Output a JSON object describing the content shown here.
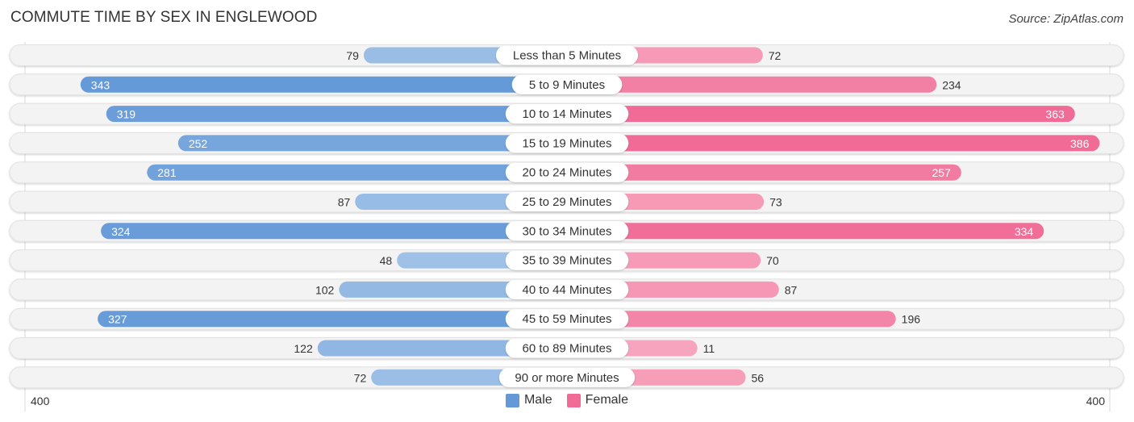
{
  "header": {
    "title": "COMMUTE TIME BY SEX IN ENGLEWOOD",
    "source": "Source: ZipAtlas.com"
  },
  "colors": {
    "male": "#6499d8",
    "male_light": "#a8c7e9",
    "female": "#f06b96",
    "female_light": "#f7a6bf",
    "track": "#f3f3f3"
  },
  "chart_data": {
    "type": "bar",
    "orientation": "horizontal-diverging",
    "title": "COMMUTE TIME BY SEX IN ENGLEWOOD",
    "categories": [
      "Less than 5 Minutes",
      "5 to 9 Minutes",
      "10 to 14 Minutes",
      "15 to 19 Minutes",
      "20 to 24 Minutes",
      "25 to 29 Minutes",
      "30 to 34 Minutes",
      "35 to 39 Minutes",
      "40 to 44 Minutes",
      "45 to 59 Minutes",
      "60 to 89 Minutes",
      "90 or more Minutes"
    ],
    "series": [
      {
        "name": "Male",
        "side": "left",
        "values": [
          79,
          343,
          319,
          252,
          281,
          87,
          324,
          48,
          102,
          327,
          122,
          72
        ]
      },
      {
        "name": "Female",
        "side": "right",
        "values": [
          72,
          234,
          363,
          386,
          257,
          73,
          334,
          70,
          87,
          196,
          11,
          56
        ]
      }
    ],
    "axis": {
      "left_label": "400",
      "right_label": "400",
      "max": 400
    },
    "legend": {
      "position": "bottom-center",
      "entries": [
        "Male",
        "Female"
      ]
    },
    "grid": false
  }
}
